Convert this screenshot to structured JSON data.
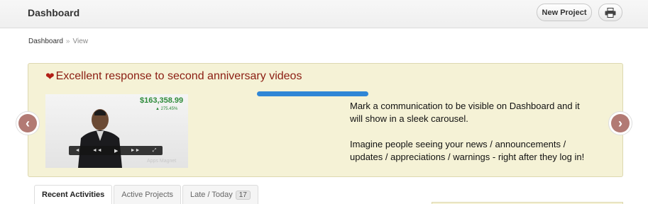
{
  "header": {
    "title": "Dashboard",
    "new_project_label": "New Project",
    "print_icon": "printer-icon"
  },
  "breadcrumb": {
    "root": "Dashboard",
    "separator": "»",
    "current": "View"
  },
  "carousel": {
    "heading": "Excellent response to second anniversary videos",
    "video": {
      "amount": "$163,358.99",
      "change": "▲ 275.45%",
      "brand": "Apps Magnet"
    },
    "progress_fraction": 1.0,
    "description": {
      "p1": "Mark a communication to be visible on Dashboard and it will show in a sleek carousel.",
      "p2": "Imagine people seeing your news / announcements / updates / appreciations / warnings - right after they log in!"
    },
    "prev_icon": "chevron-left-icon",
    "next_icon": "chevron-right-icon"
  },
  "tabs": [
    {
      "label": "Recent Activities",
      "active": true
    },
    {
      "label": "Active Projects",
      "active": false
    },
    {
      "label": "Late / Today",
      "count": "17",
      "active": false
    }
  ]
}
